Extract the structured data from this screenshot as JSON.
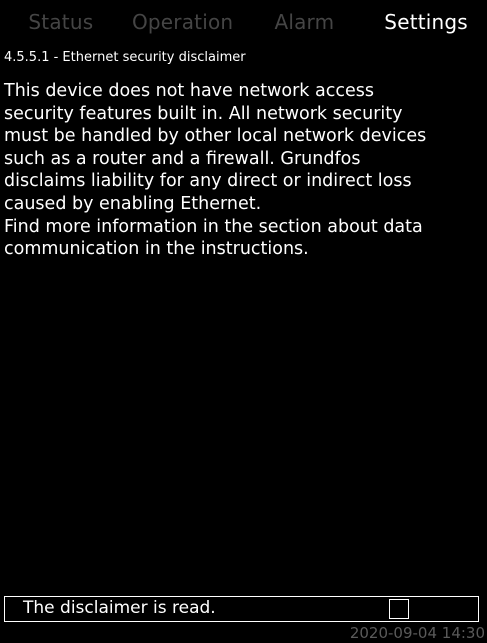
{
  "tabs": [
    {
      "label": "Status",
      "active": false
    },
    {
      "label": "Operation",
      "active": false
    },
    {
      "label": "Alarm",
      "active": false
    },
    {
      "label": "Settings",
      "active": true
    }
  ],
  "page_title": "4.5.5.1 - Ethernet security disclaimer",
  "body_text": "This device does not have network access\nsecurity features built in. All network security\nmust be handled by other local network devices\nsuch as a router and a firewall. Grundfos\ndisclaims liability for any direct or indirect loss\ncaused by enabling Ethernet.\nFind more information in the section about data\ncommunication in the instructions.",
  "disclaimer": {
    "label": "The disclaimer is read.",
    "checked": false
  },
  "status_bar": {
    "datetime": "2020-09-04  14:30"
  },
  "colors": {
    "background": "#000000",
    "text": "#ffffff",
    "inactive_tab": "#454545",
    "datetime": "#5a5a5a"
  }
}
